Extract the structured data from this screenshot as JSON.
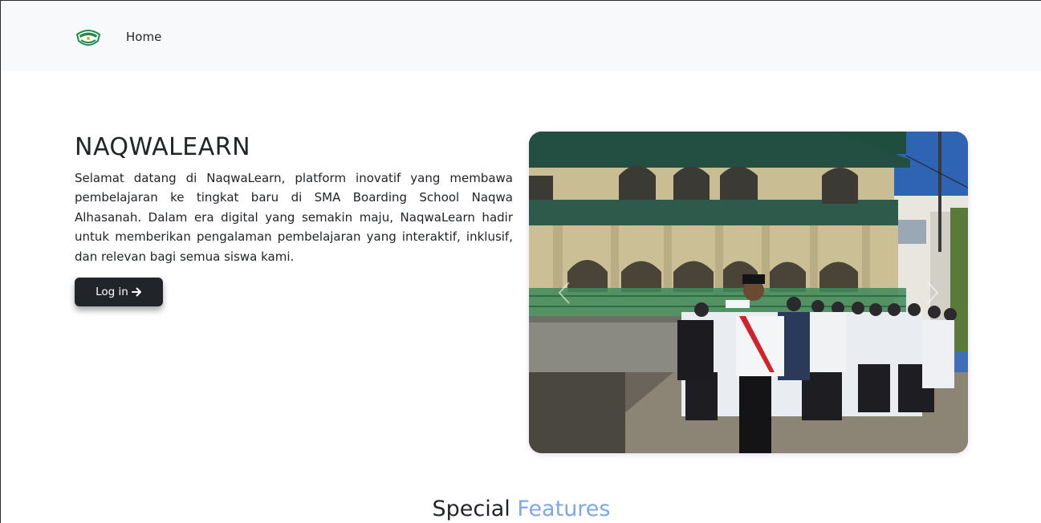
{
  "navbar": {
    "logo_icon": "school-logo-icon",
    "home_label": "Home"
  },
  "hero": {
    "title": "NAQWALEARN",
    "description": "Selamat datang di NaqwaLearn, platform inovatif yang membawa pembelajaran ke tingkat baru di SMA Boarding School Naqwa Alhasanah. Dalam era digital yang semakin maju, NaqwaLearn hadir untuk memberikan pengalaman pembelajaran yang interaktif, inklusif, dan relevan bagi semua siswa kami.",
    "login_label": "Log in",
    "login_icon": "arrow-right-icon"
  },
  "carousel": {
    "prev_icon": "chevron-left-icon",
    "next_icon": "chevron-right-icon"
  },
  "features": {
    "heading_main": "Special",
    "heading_accent": "Features"
  },
  "colors": {
    "navbar_bg": "#f8f9fa",
    "button_bg": "#212529",
    "accent": "#7ea7e8",
    "logo_green": "#1e8a4c"
  }
}
